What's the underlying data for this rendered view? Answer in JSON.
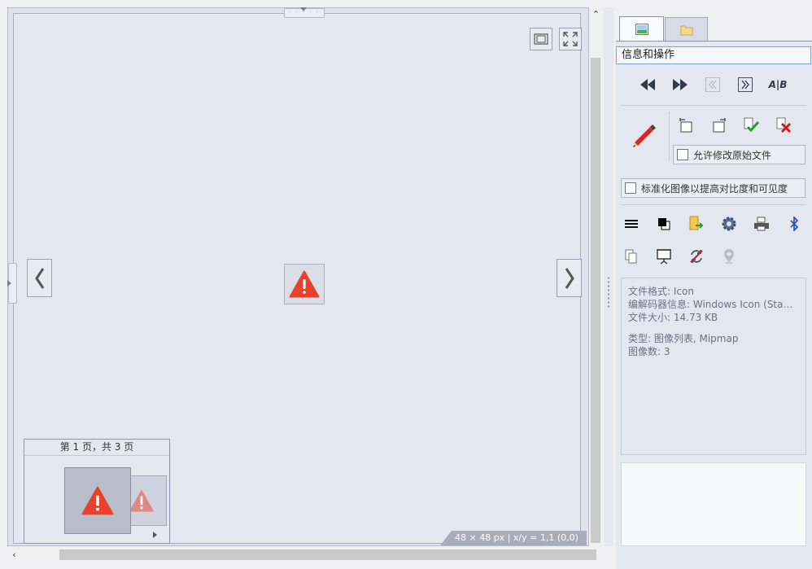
{
  "viewer": {
    "top_handle_dots": "· · · · ·",
    "prev_arrow": "‹",
    "next_arrow": "›",
    "thumbnail": {
      "page_label": "第 1 页，共 3 页"
    },
    "status": "48 × 48 px | x/y = 1,1 (0,0)"
  },
  "scrollbars": {
    "up_arrow": "⌃",
    "left_arrow": "‹"
  },
  "side_panel": {
    "tabs": [
      {
        "name": "image-tab",
        "icon": "picture-icon",
        "active": true
      },
      {
        "name": "folder-tab",
        "icon": "folder-icon",
        "active": false
      }
    ],
    "header": "信息和操作",
    "nav_buttons": [
      {
        "name": "first-image-button",
        "icon": "rewind-icon"
      },
      {
        "name": "last-image-button",
        "icon": "fast-forward-icon"
      },
      {
        "name": "prev-page-button",
        "icon": "double-chevron-left-icon",
        "disabled": true
      },
      {
        "name": "next-page-button",
        "icon": "double-chevron-right-icon"
      },
      {
        "name": "ab-compare-button",
        "icon": "a-b-compare-icon",
        "text": "A|B"
      }
    ],
    "allow_modify_label": "允许修改原始文件",
    "normalize_label": "标准化图像以提高对比度和可见度",
    "info": {
      "format": "文件格式: Icon",
      "codec": "编解码器信息: Windows Icon (Standard)",
      "size": "文件大小: 14.73 KB",
      "type": "类型: 图像列表, Mipmap",
      "count": "图像数: 3"
    }
  },
  "colors": {
    "warning_red": "#e8412c",
    "pencil_red": "#d9262a",
    "check_green": "#1fa02b",
    "delete_red": "#d11b1b",
    "bluetooth_blue": "#2a5aa8"
  }
}
